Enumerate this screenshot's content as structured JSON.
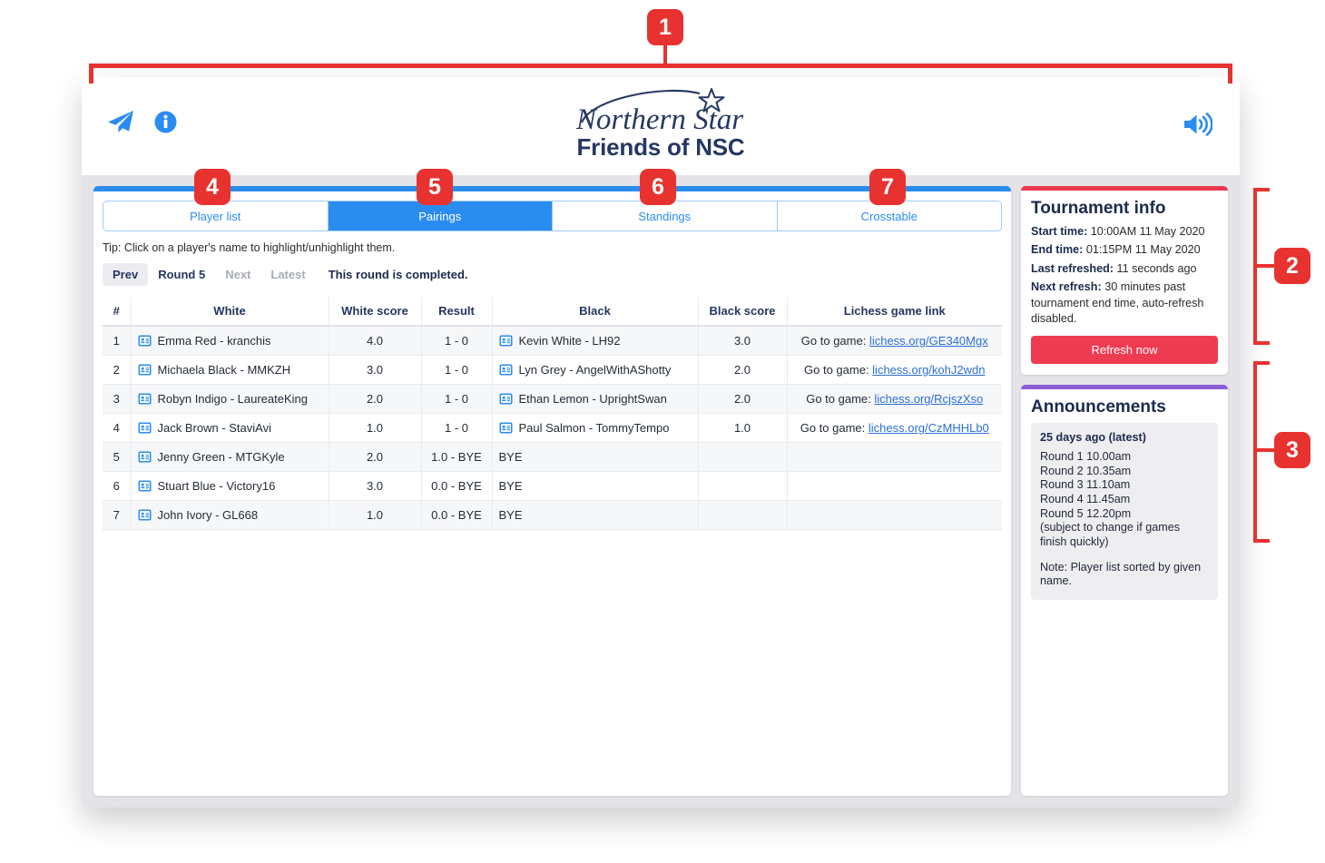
{
  "header": {
    "brand_script": "Northern Star",
    "brand_title": "Friends of NSC",
    "telegram_icon": "paper-plane-icon",
    "info_icon": "info-circle-icon",
    "sound_icon": "volume-up-icon"
  },
  "tabs": [
    {
      "label": "Player list",
      "active": false
    },
    {
      "label": "Pairings",
      "active": true
    },
    {
      "label": "Standings",
      "active": false
    },
    {
      "label": "Crosstable",
      "active": false
    }
  ],
  "tip": "Tip: Click on a player's name to highlight/unhighlight them.",
  "round_nav": {
    "prev": "Prev",
    "current": "Round 5",
    "next": "Next",
    "latest": "Latest",
    "status": "This round is completed."
  },
  "table": {
    "columns": [
      "#",
      "White",
      "White score",
      "Result",
      "Black",
      "Black score",
      "Lichess game link"
    ],
    "link_prefix": "Go to game: ",
    "rows": [
      {
        "num": "1",
        "white": "Emma Red - kranchis",
        "white_score": "4.0",
        "result": "1 - 0",
        "black": "Kevin White - LH92",
        "black_score": "3.0",
        "link": "lichess.org/GE340Mgx",
        "has_link": true,
        "black_is_bye": false
      },
      {
        "num": "2",
        "white": "Michaela Black - MMKZH",
        "white_score": "3.0",
        "result": "1 - 0",
        "black": "Lyn Grey - AngelWithAShotty",
        "black_score": "2.0",
        "link": "lichess.org/kohJ2wdn",
        "has_link": true,
        "black_is_bye": false
      },
      {
        "num": "3",
        "white": "Robyn Indigo - LaureateKing",
        "white_score": "2.0",
        "result": "1 - 0",
        "black": "Ethan Lemon - UprightSwan",
        "black_score": "2.0",
        "link": "lichess.org/RcjszXso",
        "has_link": true,
        "black_is_bye": false
      },
      {
        "num": "4",
        "white": "Jack Brown - StaviAvi",
        "white_score": "1.0",
        "result": "1 - 0",
        "black": "Paul Salmon - TommyTempo",
        "black_score": "1.0",
        "link": "lichess.org/CzMHHLb0",
        "has_link": true,
        "black_is_bye": false
      },
      {
        "num": "5",
        "white": "Jenny Green - MTGKyle",
        "white_score": "2.0",
        "result": "1.0 - BYE",
        "black": "BYE",
        "black_score": "",
        "link": "",
        "has_link": false,
        "black_is_bye": true
      },
      {
        "num": "6",
        "white": "Stuart Blue - Victory16",
        "white_score": "3.0",
        "result": "0.0 - BYE",
        "black": "BYE",
        "black_score": "",
        "link": "",
        "has_link": false,
        "black_is_bye": true
      },
      {
        "num": "7",
        "white": "John Ivory - GL668",
        "white_score": "1.0",
        "result": "0.0 - BYE",
        "black": "BYE",
        "black_score": "",
        "link": "",
        "has_link": false,
        "black_is_bye": true
      }
    ]
  },
  "tournament_info": {
    "title": "Tournament info",
    "start_label": "Start time:",
    "start_value": "10:00AM 11 May 2020",
    "end_label": "End time:",
    "end_value": "01:15PM 11 May 2020",
    "refreshed_label": "Last refreshed:",
    "refreshed_value": "11 seconds ago",
    "next_label": "Next refresh:",
    "next_value": "30 minutes past tournament end time, auto-refresh disabled.",
    "refresh_button": "Refresh now"
  },
  "announcements": {
    "title": "Announcements",
    "date": "25 days ago (latest)",
    "body": "Round 1 10.00am\nRound 2 10.35am\nRound 3 11.10am\nRound 4 11.45am\nRound 5 12.20pm\n(subject to change if games finish quickly)",
    "note": "Note: Player list sorted by given name."
  },
  "annotations": {
    "badges": [
      "1",
      "2",
      "3",
      "4",
      "5",
      "6",
      "7"
    ]
  },
  "colors": {
    "accent_blue": "#2b8cf0",
    "brand_navy": "#253761",
    "annotation_red": "#e8322f",
    "refresh_red": "#ef3b52",
    "announce_purple": "#8b5cd6",
    "body_gray": "#e3e3e8"
  }
}
